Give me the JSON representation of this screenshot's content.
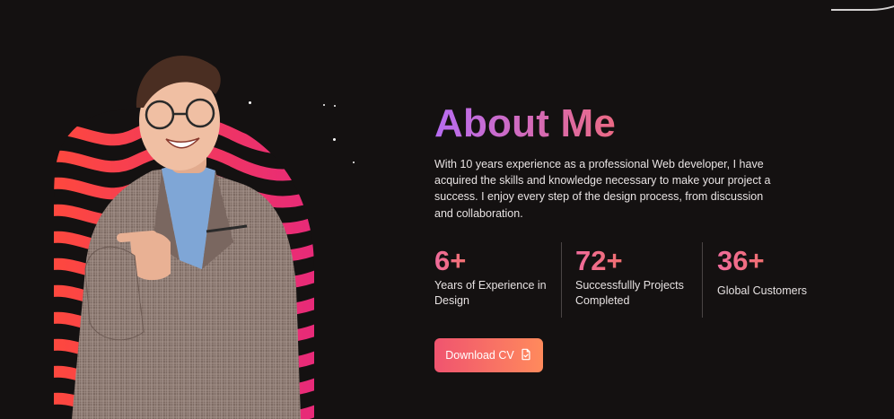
{
  "about": {
    "title": "About Me",
    "description": "With 10 years experience as a professional Web developer, I have acquired the skills and knowledge necessary to make your project a success. I enjoy every step of the design process, from discussion and collaboration."
  },
  "stats": [
    {
      "value": "6+",
      "label": "Years of Experience in Design"
    },
    {
      "value": "72+",
      "label": "Successfullly Projects Completed"
    },
    {
      "value": "36+",
      "label": "Global Customers"
    }
  ],
  "cta": {
    "label": "Download CV",
    "icon": "document-icon"
  },
  "colors": {
    "background": "#141111",
    "accent_start": "#f0546f",
    "accent_end": "#ff8a5c",
    "title_purple": "#b76cf3",
    "title_orange": "#ff8f5e"
  }
}
